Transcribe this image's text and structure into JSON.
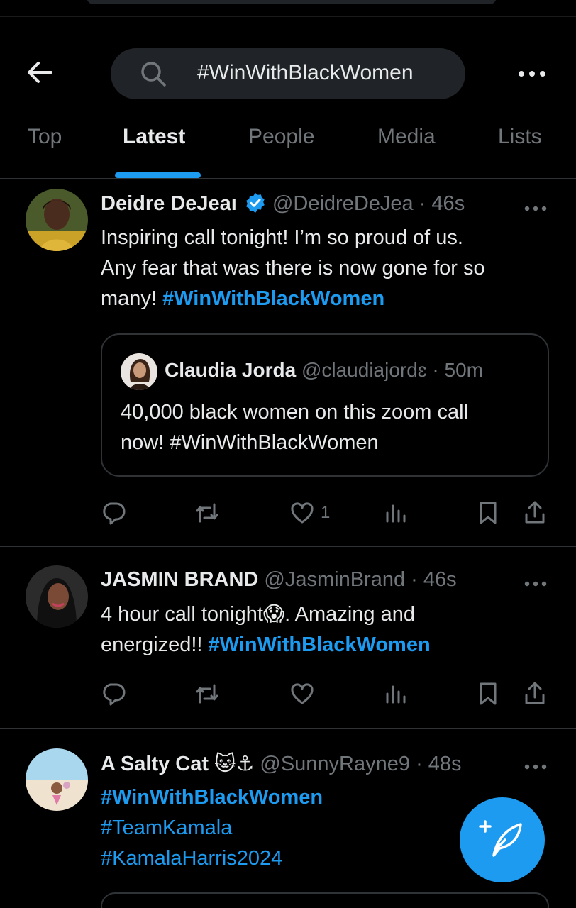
{
  "search": {
    "query": "#WinWithBlackWomen"
  },
  "tabs": [
    {
      "label": "Top"
    },
    {
      "label": "Latest"
    },
    {
      "label": "People"
    },
    {
      "label": "Media"
    },
    {
      "label": "Lists"
    }
  ],
  "active_tab": "Latest",
  "tweets": [
    {
      "name": "Deidre DeJeaı",
      "verified": true,
      "handle": "@DeidreDeJea",
      "time": "· 46s",
      "text_line1": "Inspiring call tonight! I’m so proud of us.",
      "text_line2": "Any fear that was there is now gone for so",
      "text_line3": "many! ",
      "hashtag": "#WinWithBlackWomen",
      "quote": {
        "name": "Claudia Jorda",
        "handle": "@claudiajordɛ",
        "time": "· 50m",
        "text_line1": "40,000 black women on this zoom call",
        "text_line2": "now! #WinWithBlackWomen"
      },
      "likes": "1"
    },
    {
      "name": "JASMIN BRAND",
      "handle": "@JasminBrand",
      "time": "· 46s",
      "text_line1_a": "4 hour call tonight",
      "emoji": "😱",
      "text_line1_b": ". Amazing and",
      "text_line2": "energized!! ",
      "hashtag": "#WinWithBlackWomen"
    },
    {
      "name": "A Salty Cat",
      "emoji": "🐱⚓",
      "handle": "@SunnyRayne9",
      "time": "· 48s",
      "hashtag1": "#WinWithBlackWomen",
      "hashtag2": "#TeamKamala",
      "hashtag3": "#KamalaHarris2024"
    }
  ],
  "colors": {
    "accent": "#1d9bf0",
    "muted": "#71767b",
    "text": "#e7e9ea",
    "border": "#2f3336",
    "verified": "#1d9bf0"
  },
  "icons": [
    "back-arrow-icon",
    "search-icon",
    "more-icon",
    "verified-icon",
    "reply-icon",
    "retweet-icon",
    "like-icon",
    "views-icon",
    "bookmark-icon",
    "share-icon",
    "compose-icon"
  ]
}
